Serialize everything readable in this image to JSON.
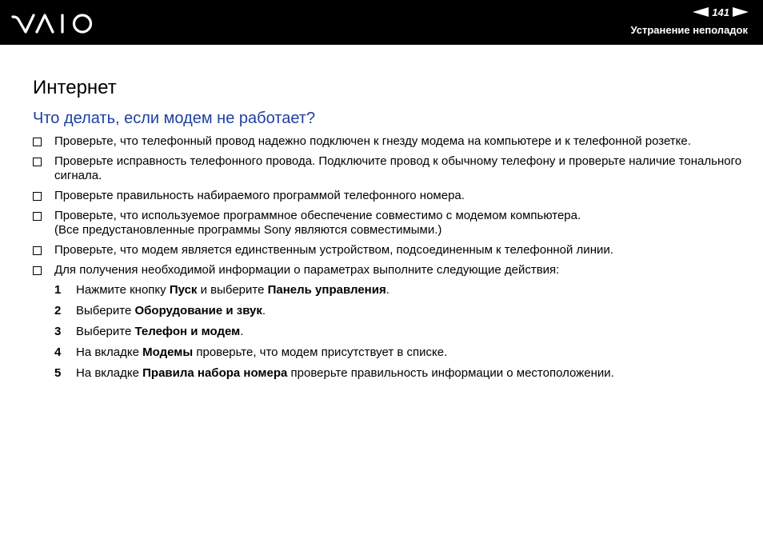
{
  "header": {
    "logo_text": "VAIO",
    "page_number": "141",
    "section_title": "Устранение неполадок"
  },
  "main": {
    "title": "Интернет",
    "subtitle": "Что делать, если модем не работает?",
    "checklist": [
      "Проверьте, что телефонный провод надежно подключен к гнезду модема на компьютере и к телефонной розетке.",
      "Проверьте исправность телефонного провода. Подключите провод к обычному телефону и проверьте наличие тонального сигнала.",
      "Проверьте правильность набираемого программой телефонного номера.",
      "Проверьте, что используемое программное обеспечение совместимо с модемом компьютера.",
      "Проверьте, что модем является единственным устройством, подсоединенным к телефонной линии.",
      "Для получения необходимой информации о параметрах выполните следующие действия:"
    ],
    "checklist_note": "(Все предустановленные программы Sony являются совместимыми.)",
    "steps": [
      {
        "n": "1",
        "a": "Нажмите кнопку ",
        "b1": "Пуск",
        "c": " и выберите ",
        "b2": "Панель управления",
        "d": "."
      },
      {
        "n": "2",
        "a": "Выберите ",
        "b1": "Оборудование и звук",
        "c": "."
      },
      {
        "n": "3",
        "a": "Выберите ",
        "b1": "Телефон и модем",
        "c": "."
      },
      {
        "n": "4",
        "a": "На вкладке ",
        "b1": "Модемы",
        "c": " проверьте, что модем присутствует в списке."
      },
      {
        "n": "5",
        "a": "На вкладке ",
        "b1": "Правила набора номера",
        "c": " проверьте правильность информации о местоположении."
      }
    ]
  }
}
